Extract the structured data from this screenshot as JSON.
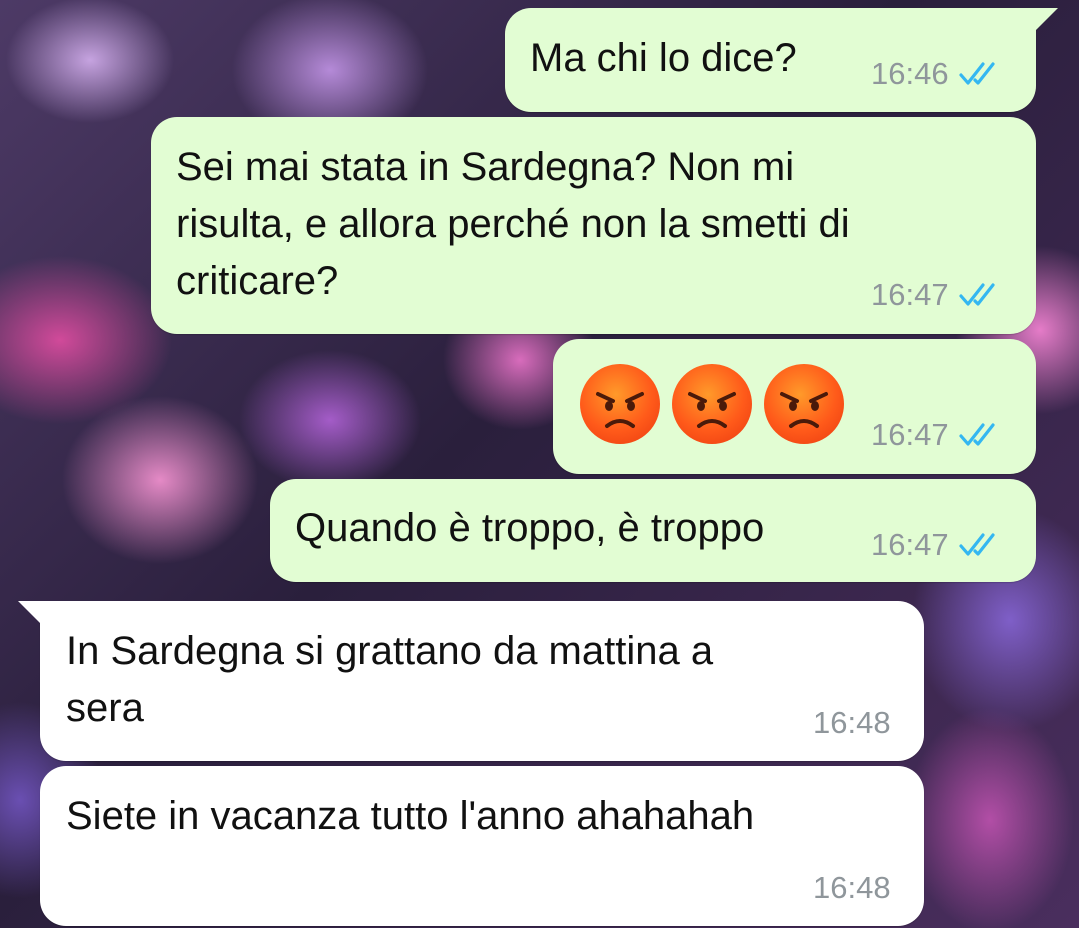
{
  "messages": [
    {
      "text": "Ma chi lo dice?",
      "time": "16:46"
    },
    {
      "text": "Sei mai stata in Sardegna? Non mi\nrisulta, e allora perché non la smetti di\ncriticare?",
      "time": "16:47"
    },
    {
      "emoji": [
        "angry-face",
        "angry-face",
        "angry-face"
      ],
      "time": "16:47"
    },
    {
      "text": "Quando è troppo, è troppo",
      "time": "16:47"
    },
    {
      "text": "In Sardegna si grattano da mattina a\nsera",
      "time": "16:48"
    },
    {
      "text": "Siete in vacanza tutto l'anno ahahahah",
      "time": "16:48"
    }
  ],
  "colors": {
    "outgoing_bubble": "#e2fdd3",
    "incoming_bubble": "#ffffff",
    "read_ticks": "#34b7f1",
    "timestamp": "#8f969b"
  }
}
